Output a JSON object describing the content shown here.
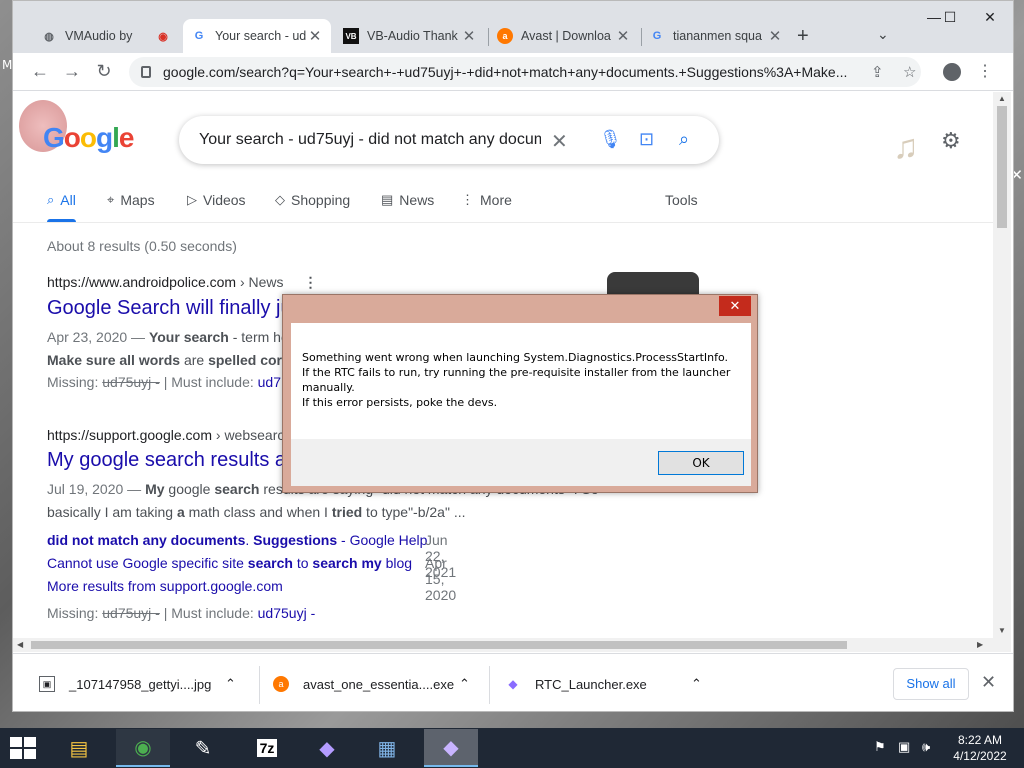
{
  "browser": {
    "tabs": [
      {
        "title": "VMAudio by",
        "favicon": "globe-icon",
        "active": false
      },
      {
        "title": "Your search - ud",
        "favicon": "google-g-icon",
        "active": true
      },
      {
        "title": "VB-Audio Thank",
        "favicon": "vb-icon",
        "active": false
      },
      {
        "title": "Avast | Downloa",
        "favicon": "avast-icon",
        "active": false
      },
      {
        "title": "tiananmen squa",
        "favicon": "google-g-icon",
        "active": false
      }
    ],
    "new_tab": "+",
    "url": "google.com/search?q=Your+search+-+ud75uyj+-+did+not+match+any+documents.+Suggestions%3A+Make..."
  },
  "google": {
    "logo": [
      "G",
      "o",
      "o",
      "g",
      "l",
      "e"
    ],
    "logo_colors": [
      "#4285f4",
      "#ea4335",
      "#fbbc05",
      "#4285f4",
      "#34a853",
      "#ea4335"
    ],
    "query": "Your search - ud75uyj - did not match any documents",
    "nav_tabs": [
      {
        "label": "All",
        "icon": "search-icon",
        "active": true
      },
      {
        "label": "Maps",
        "icon": "map-pin-icon"
      },
      {
        "label": "Videos",
        "icon": "play-icon"
      },
      {
        "label": "Shopping",
        "icon": "tag-icon"
      },
      {
        "label": "News",
        "icon": "news-icon"
      },
      {
        "label": "More",
        "icon": "more-icon"
      }
    ],
    "tools": "Tools",
    "stats": "About 8 results (0.50 seconds)",
    "results": [
      {
        "site": "https://www.androidpolice.com",
        "crumb": "› News",
        "title": "Google Search will finally ju",
        "date": "Apr 23, 2020 —",
        "snippet_bold": "Your search",
        "snippet_rest": " - term he",
        "line2_a": "Make sure all words",
        "line2_b": " are ",
        "line2_c": "spelled corre",
        "missing_label": "Missing:",
        "missing_term": "ud75uyj -",
        "must_label": "| Must include:",
        "must_term": "ud7"
      },
      {
        "site": "https://support.google.com",
        "crumb": "› websearch",
        "title": "My google search results a",
        "date": "Jul 19, 2020 —",
        "snippet_bold": "My",
        "snippet_mid": " google ",
        "snippet_bold2": "search",
        "snippet_rest": " results are saying \"did not match any documents\" . So",
        "line2": "basically I am taking ",
        "line2_b": "a",
        "line2_c": " math class and when I ",
        "line2_d": "tried",
        "line2_e": " to type\"-b/2a\" ..."
      }
    ],
    "sublinks": [
      {
        "a": "did not match any documents",
        "b": ". ",
        "c": "Suggestions",
        "d": " - Google Help",
        "date": "Jun 22, 2021"
      },
      {
        "a": "Cannot use Google specific site ",
        "b": "search",
        "c": " to ",
        "d": "search my",
        "e": " blog",
        "date": "Apr 15, 2020"
      }
    ],
    "more_results": "More results from support.google.com",
    "missing2_label": "Missing:",
    "missing2_term": "ud75uyj -",
    "must2_label": "| Must include:",
    "must2_term": "ud75uyj -"
  },
  "dialog": {
    "lines": [
      "Something went wrong when launching System.Diagnostics.ProcessStartInfo.",
      "If the RTC fails to run, try running the pre-requisite installer from the launcher manually.",
      "If this error persists, poke the devs."
    ],
    "ok": "OK",
    "close": "✕"
  },
  "downloads": [
    {
      "name": "_107147958_gettyi....jpg",
      "icon": "image-file-icon"
    },
    {
      "name": "avast_one_essentia....exe",
      "icon": "avast-icon"
    },
    {
      "name": "RTC_Launcher.exe",
      "icon": "diamond-icon"
    }
  ],
  "show_all": "Show all",
  "taskbar": {
    "apps": [
      {
        "name": "file-explorer-icon",
        "glyph": "▤",
        "color": "#f5c542"
      },
      {
        "name": "chrome-icon",
        "glyph": "◉",
        "color": "#4caf50"
      },
      {
        "name": "notepad-icon",
        "glyph": "✎",
        "color": "#ffffff"
      },
      {
        "name": "7zip-icon",
        "glyph": "7z",
        "color": "#ffffff"
      },
      {
        "name": "diamond-app-icon",
        "glyph": "◆",
        "color": "#b49cff"
      },
      {
        "name": "control-panel-icon",
        "glyph": "▦",
        "color": "#7fb3e6"
      },
      {
        "name": "rtc-launcher-icon",
        "glyph": "◆",
        "color": "#c8b4ff"
      }
    ],
    "time": "8:22 AM",
    "date": "4/12/2022"
  }
}
